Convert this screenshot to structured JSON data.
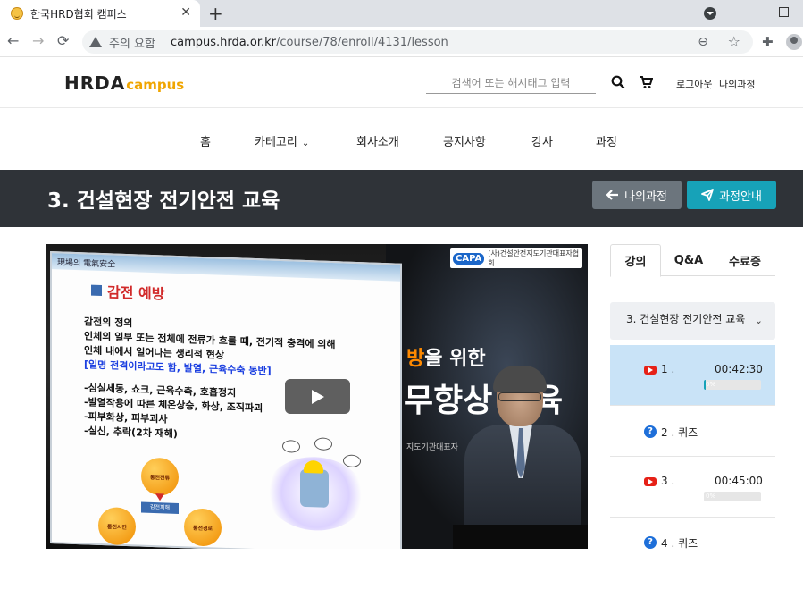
{
  "browser": {
    "tab_title": "한국HRD협회 캠퍼스",
    "close_glyph": "✕",
    "new_tab_glyph": "+",
    "warning_text": "주의 요함",
    "url_host": "campus.hrda.or.kr",
    "url_path": "/course/78/enroll/4131/lesson",
    "nav_back": "←",
    "nav_forward": "→",
    "nav_reload": "⟳"
  },
  "header": {
    "logo_text": "HRDA",
    "logo_sub": "campus",
    "search_placeholder": "검색어 또는 해시태그 입력",
    "logout_label": "로그아웃",
    "mycourse_label": "나의과정"
  },
  "nav": {
    "items": [
      "홈",
      "카테고리",
      "회사소개",
      "공지사항",
      "강사",
      "과정"
    ]
  },
  "banner": {
    "title": "3. 건설현장 전기안전 교육",
    "mycourse_button": "나의과정",
    "info_button": "과정안내"
  },
  "video": {
    "slide_header": "現場의 電氣安全",
    "slide_title": "감전 예방",
    "slide_lines": [
      "감전의 정의",
      "인체의 일부 또는 전체에 전류가 흐를 때, 전기적 충격에 의해",
      "인체 내에서 일어나는 생리적 현상",
      "[일명 전격이라고도 함, 발열, 근육수축 동반]",
      "",
      "-심실세동, 쇼크, 근육수축, 호흡정지",
      "-발열작용에 따른 체온상승, 화상, 조직파괴",
      "-피부화상, 피부괴사",
      "-실신, 추락(2차 재해)"
    ],
    "diagram": {
      "top": "통전전류",
      "center": "감전피해",
      "left": "통전시간",
      "right": "통전경로"
    },
    "capa_mark": "CAPA",
    "capa_org": "(사)건설안전지도기관대표자협회",
    "bg_line1_orange": "방",
    "bg_line1_rest": "을 위한",
    "bg_line2": "무향상 교육",
    "bg_org": "지도기관대표자"
  },
  "sidebar": {
    "tabs": [
      "강의",
      "Q&A",
      "수료증"
    ],
    "course_title": "3. 건설현장 전기안전 교육",
    "lessons": [
      {
        "num": "1 .",
        "duration": "00:42:30",
        "progress_label": "0%",
        "progress": 0.03,
        "type": "video"
      },
      {
        "num": "2 . 퀴즈",
        "type": "quiz"
      },
      {
        "num": "3 .",
        "duration": "00:45:00",
        "progress_label": "0%",
        "progress": 0,
        "type": "video"
      },
      {
        "num": "4 . 퀴즈",
        "type": "quiz"
      }
    ]
  },
  "colors": {
    "banner_bg": "#2f3338",
    "info_button": "#17a2b8",
    "mycourse_button": "#6c757d",
    "active_lesson": "#c9e3f7",
    "logo_accent": "#f0a500"
  }
}
